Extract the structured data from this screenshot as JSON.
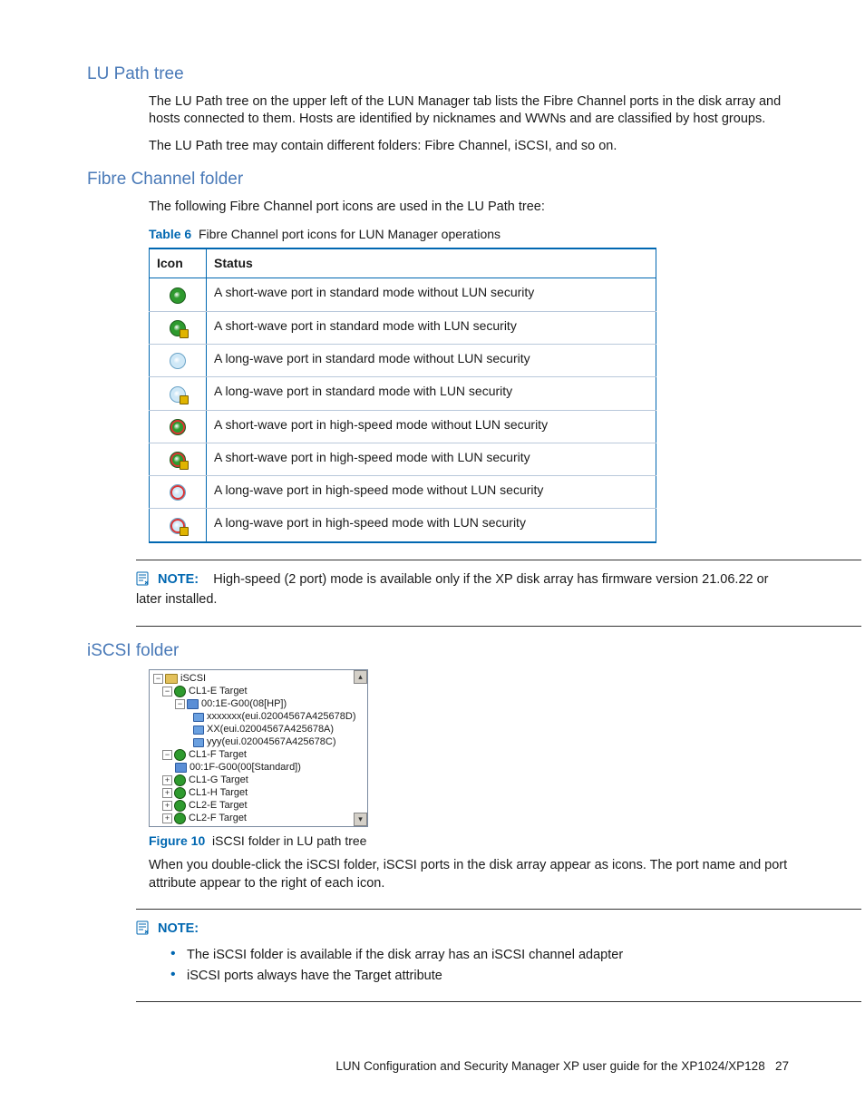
{
  "sections": {
    "lu_path": {
      "heading": "LU Path tree",
      "p1": "The LU Path tree on the upper left of the LUN Manager tab lists the Fibre Channel ports in the disk array and hosts connected to them. Hosts are identified by nicknames and WWNs and are classified by host groups.",
      "p2": "The LU Path tree may contain different folders: Fibre Channel, iSCSI, and so on."
    },
    "fc": {
      "heading": "Fibre Channel folder",
      "p1": "The following Fibre Channel port icons are used in the LU Path tree:",
      "table_caption_label": "Table 6",
      "table_caption_text": "Fibre Channel port icons for LUN Manager operations",
      "col_icon": "Icon",
      "col_status": "Status",
      "rows": {
        "0": "A short-wave port in standard mode without LUN security",
        "1": "A short-wave port in standard mode with LUN security",
        "2": "A long-wave port in standard mode without LUN security",
        "3": "A long-wave port in standard mode with LUN security",
        "4": "A short-wave port in high-speed mode without LUN security",
        "5": "A short-wave port in high-speed mode with LUN security",
        "6": "A long-wave port in high-speed mode without LUN security",
        "7": "A long-wave port in high-speed mode with LUN security"
      },
      "note_label": "NOTE:",
      "note_text": "High-speed (2 port) mode is available only if the XP disk array has firmware version 21.06.22 or later installed."
    },
    "iscsi": {
      "heading": "iSCSI folder",
      "tree": {
        "root": "iSCSI",
        "n1": "CL1-E Target",
        "n1_g": "00:1E-G00(08[HP])",
        "n1_h1": "xxxxxxx(eui.02004567A425678D)",
        "n1_h2": "XX(eui.02004567A425678A)",
        "n1_h3": "yyy(eui.02004567A425678C)",
        "n2": "CL1-F Target",
        "n2_g": "00:1F-G00(00[Standard])",
        "n3": "CL1-G Target",
        "n4": "CL1-H Target",
        "n5": "CL2-E Target",
        "n6": "CL2-F Target"
      },
      "fig_label": "Figure 10",
      "fig_text": "iSCSI folder in LU path tree",
      "p1": "When you double-click the iSCSI folder, iSCSI ports in the disk array appear as icons. The port name and port attribute appear to the right of each icon.",
      "note_label": "NOTE:",
      "bullet1": "The iSCSI folder is available if the disk array has an iSCSI channel adapter",
      "bullet2": "iSCSI ports always have the Target attribute"
    }
  },
  "footer": {
    "text": "LUN Configuration and Security Manager XP user guide for the XP1024/XP128",
    "page": "27"
  }
}
